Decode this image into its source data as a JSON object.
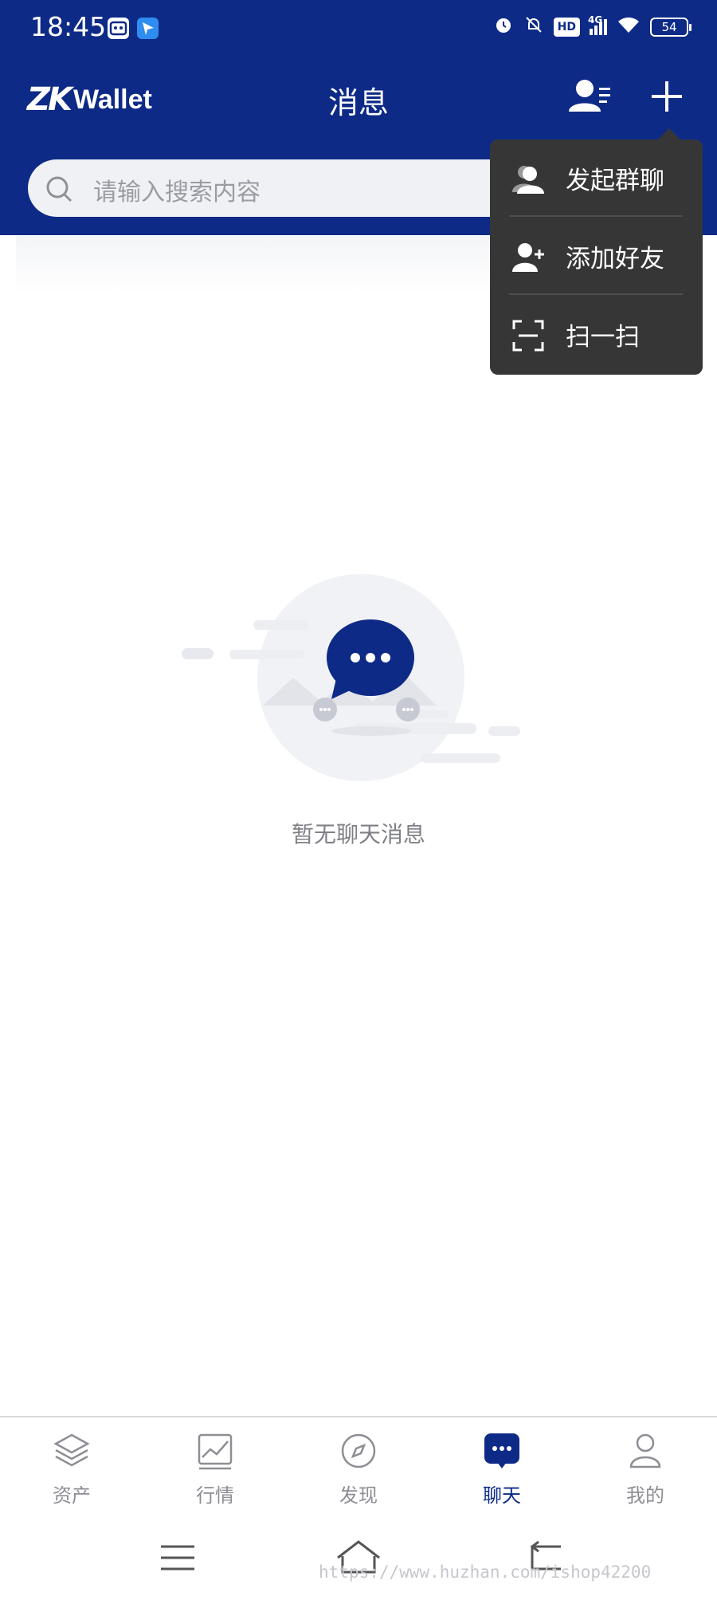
{
  "status_bar": {
    "time": "18:45",
    "hd": "HD",
    "network": "4G",
    "battery": "54"
  },
  "header": {
    "brand_mark": "ZK",
    "brand_name": "Wallet",
    "title": "消息"
  },
  "search": {
    "placeholder": "请输入搜索内容"
  },
  "popup_menu": {
    "items": [
      {
        "label": "发起群聊",
        "icon": "group-chat-icon"
      },
      {
        "label": "添加好友",
        "icon": "add-friend-icon"
      },
      {
        "label": "扫一扫",
        "icon": "scan-icon"
      }
    ]
  },
  "empty_state": {
    "text": "暂无聊天消息"
  },
  "tabs": [
    {
      "label": "资产",
      "icon": "layers-icon"
    },
    {
      "label": "行情",
      "icon": "trend-chart-icon"
    },
    {
      "label": "发现",
      "icon": "compass-icon"
    },
    {
      "label": "聊天",
      "icon": "chat-bubble-icon",
      "active": true
    },
    {
      "label": "我的",
      "icon": "profile-icon"
    }
  ],
  "watermark": "https://www.huzhan.com/ishop42200",
  "colors": {
    "primary": "#0d2a87",
    "menu_bg": "#373636",
    "inactive": "#8d8e94"
  }
}
